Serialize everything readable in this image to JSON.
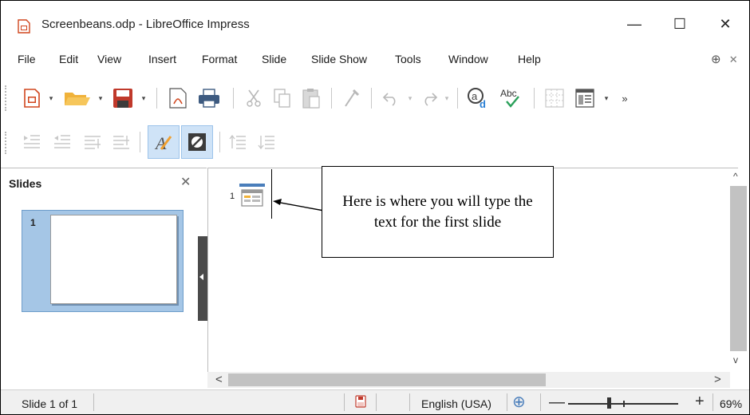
{
  "window": {
    "title": "Screenbeans.odp - LibreOffice Impress",
    "minimize": "—",
    "maximize": "☐",
    "close": "✕"
  },
  "menu": {
    "items": [
      "File",
      "Edit",
      "View",
      "Insert",
      "Format",
      "Slide",
      "Slide Show",
      "Tools",
      "Window",
      "Help"
    ],
    "right_icon": "⊕",
    "right_close": "✕"
  },
  "toolbar_icons": {
    "standard": [
      "new-document-icon",
      "open-folder-icon",
      "save-icon",
      "export-pdf-icon",
      "print-icon",
      "cut-icon",
      "copy-icon",
      "paste-icon",
      "clone-formatting-icon",
      "undo-icon",
      "redo-icon",
      "find-replace-icon",
      "spelling-icon",
      "table-icon",
      "display-views-icon",
      "more-options-icon"
    ],
    "outline": [
      "promote-icon",
      "demote-icon",
      "move-up-icon",
      "move-down-icon",
      "formatting-on-off-icon",
      "black-white-view-icon",
      "first-level-icon",
      "all-levels-icon"
    ]
  },
  "slides_panel": {
    "title": "Slides",
    "close": "✕",
    "slides": [
      {
        "number": "1"
      }
    ]
  },
  "outline": {
    "slide_number": "1"
  },
  "callout": {
    "text": "Here is where you will type the text for the first slide"
  },
  "scrollbars": {
    "up": "^",
    "down": "v",
    "left": "<",
    "right": ">"
  },
  "status": {
    "slide": "Slide 1 of 1",
    "language": "English (USA)",
    "zoom_minus": "—",
    "zoom_plus": "+",
    "zoom_level": "69%",
    "zoom_fraction": 0.69
  },
  "colors": {
    "accent": "#4a7ebb",
    "selection": "#a5c6e6",
    "save_red": "#c0392b"
  }
}
